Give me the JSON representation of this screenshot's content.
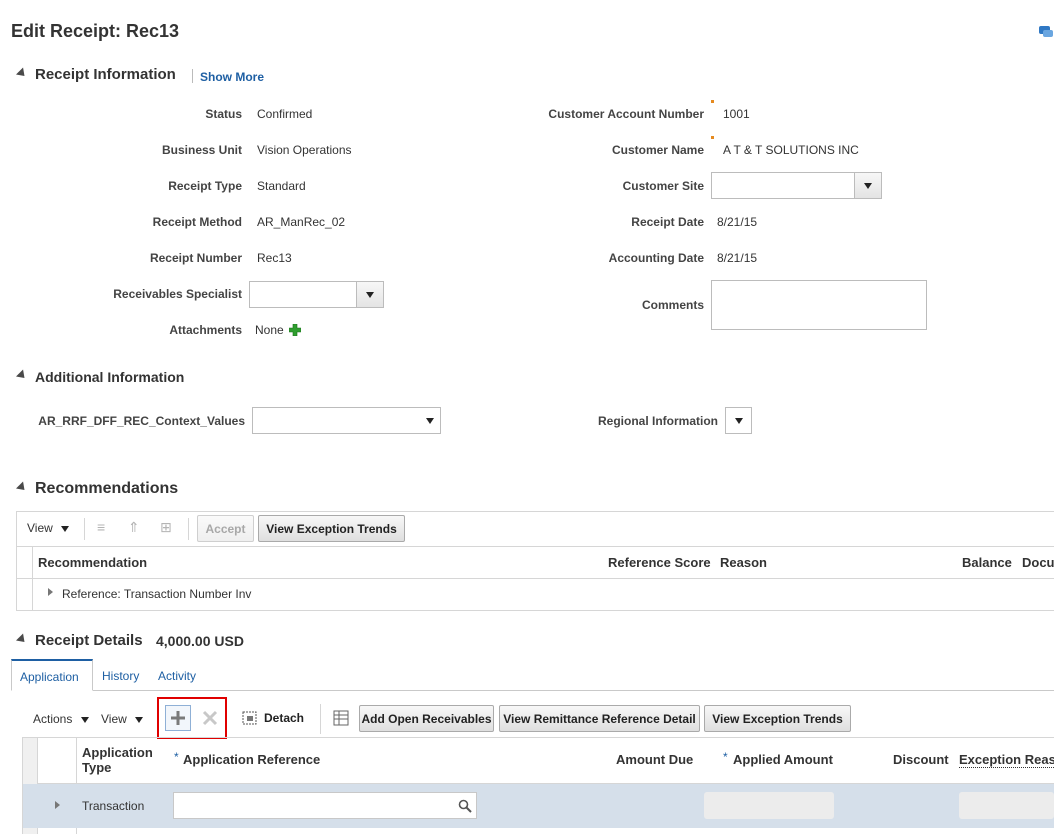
{
  "page": {
    "title": "Edit Receipt: Rec13"
  },
  "receipt_info": {
    "section_title": "Receipt Information",
    "show_more": "Show More",
    "left": {
      "status_label": "Status",
      "status_value": "Confirmed",
      "bu_label": "Business Unit",
      "bu_value": "Vision Operations",
      "type_label": "Receipt Type",
      "type_value": "Standard",
      "method_label": "Receipt Method",
      "method_value": "AR_ManRec_02",
      "number_label": "Receipt Number",
      "number_value": "Rec13",
      "specialist_label": "Receivables Specialist",
      "specialist_value": "",
      "attach_label": "Attachments",
      "attach_value": "None"
    },
    "right": {
      "account_label": "Customer Account Number",
      "account_value": "1001",
      "name_label": "Customer Name",
      "name_value": "A T & T SOLUTIONS INC",
      "site_label": "Customer Site",
      "site_value": "",
      "date_label": "Receipt Date",
      "date_value": "8/21/15",
      "acct_date_label": "Accounting Date",
      "acct_date_value": "8/21/15",
      "comments_label": "Comments",
      "comments_value": ""
    }
  },
  "additional_info": {
    "section_title": "Additional Information",
    "context_label": "AR_RRF_DFF_REC_Context_Values",
    "context_value": "",
    "regional_label": "Regional Information",
    "regional_value": ""
  },
  "recommendations": {
    "section_title": "Recommendations",
    "toolbar": {
      "view": "View",
      "accept": "Accept",
      "trends": "View Exception Trends"
    },
    "columns": [
      "Recommendation",
      "Reference Score",
      "Reason",
      "Balance",
      "Docu"
    ],
    "rows": [
      {
        "text": "Reference: Transaction Number Inv"
      }
    ]
  },
  "receipt_details": {
    "section_title": "Receipt Details",
    "amount": "4,000.00 USD",
    "tabs": [
      "Application",
      "History",
      "Activity"
    ],
    "toolbar": {
      "actions": "Actions",
      "view": "View",
      "detach": "Detach",
      "add_open": "Add Open Receivables",
      "view_remit": "View Remittance Reference Detail",
      "view_trends": "View Exception Trends"
    },
    "columns": {
      "app_type": "Application\nType",
      "app_ref_req": "*",
      "app_ref": "Application Reference",
      "amount_due": "Amount Due",
      "applied_req": "*",
      "applied": "Applied Amount",
      "discount": "Discount",
      "exception": "Exception Reas"
    },
    "rows": [
      {
        "type": "Transaction",
        "app_ref": "",
        "amount_due": "",
        "applied": "",
        "discount": "",
        "exception": ""
      }
    ]
  },
  "colors": {
    "accent_link": "#1e5fa3",
    "selected_row": "#d5dfea",
    "highlight": "#e00000",
    "required_marker": "#e58a1f"
  }
}
